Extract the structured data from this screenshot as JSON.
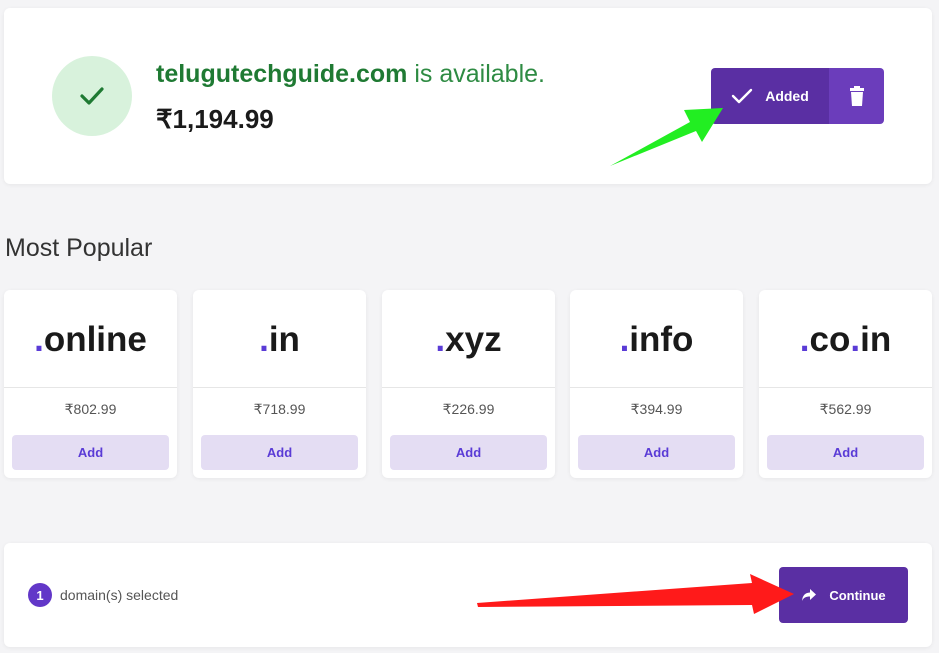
{
  "availability": {
    "domain": "telugutechguide.com",
    "status_text": " is available.",
    "price": "₹1,194.99",
    "icon": "check-icon",
    "added_label": "Added",
    "delete_icon": "trash-icon"
  },
  "most_popular": {
    "heading": "Most Popular",
    "items": [
      {
        "tld": ".online",
        "price": "₹802.99",
        "button": "Add"
      },
      {
        "tld": ".in",
        "price": "₹718.99",
        "button": "Add"
      },
      {
        "tld": ".xyz",
        "price": "₹226.99",
        "button": "Add"
      },
      {
        "tld": ".info",
        "price": "₹394.99",
        "button": "Add"
      },
      {
        "tld": ".co.in",
        "price": "₹562.99",
        "button": "Add"
      }
    ]
  },
  "footer": {
    "count": "1",
    "selected_label": "domain(s) selected",
    "continue_label": "Continue",
    "continue_icon": "share-arrow-icon"
  },
  "colors": {
    "primary": "#5a2fa3",
    "accent": "#5a3bd6",
    "success": "#2e8b43",
    "annotation_green": "#22ee22",
    "annotation_red": "#ff1a1a"
  }
}
